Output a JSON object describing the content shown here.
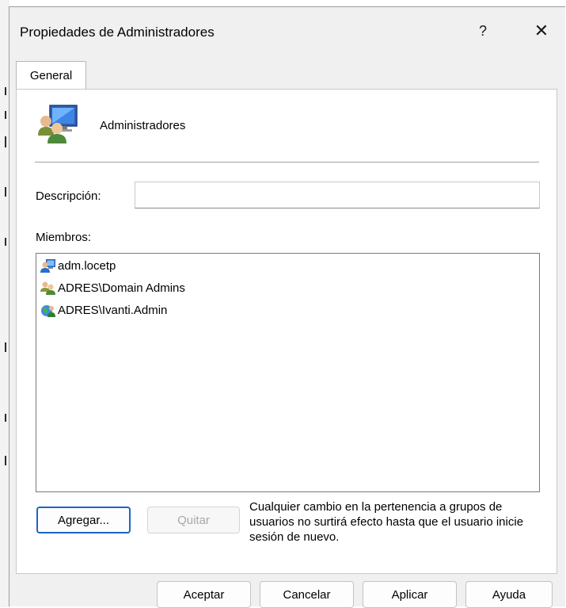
{
  "window": {
    "title": "Propiedades de Administradores",
    "help_glyph": "?",
    "close_glyph": "✕"
  },
  "tabs": [
    {
      "label": "General",
      "selected": true
    }
  ],
  "group": {
    "name": "Administradores",
    "icon": "group-computer-icon"
  },
  "description": {
    "label": "Descripción:",
    "value": ""
  },
  "members": {
    "label": "Miembros:",
    "items": [
      {
        "name": "adm.locetp",
        "icon": "local-user-icon"
      },
      {
        "name": "ADRES\\Domain Admins",
        "icon": "domain-group-icon"
      },
      {
        "name": "ADRES\\Ivanti.Admin",
        "icon": "domain-user-icon"
      }
    ]
  },
  "actions": {
    "add_label": "Agregar...",
    "remove_label": "Quitar",
    "remove_enabled": false
  },
  "note": "Cualquier cambio en la pertenencia a grupos de usuarios no surtirá efecto hasta que el usuario inicie sesión de nuevo.",
  "footer": {
    "ok_label": "Aceptar",
    "cancel_label": "Cancelar",
    "apply_label": "Aplicar",
    "help_label": "Ayuda"
  },
  "colors": {
    "accent": "#1f64c5",
    "window_bg": "#f0f0f0",
    "panel_bg": "#ffffff"
  }
}
